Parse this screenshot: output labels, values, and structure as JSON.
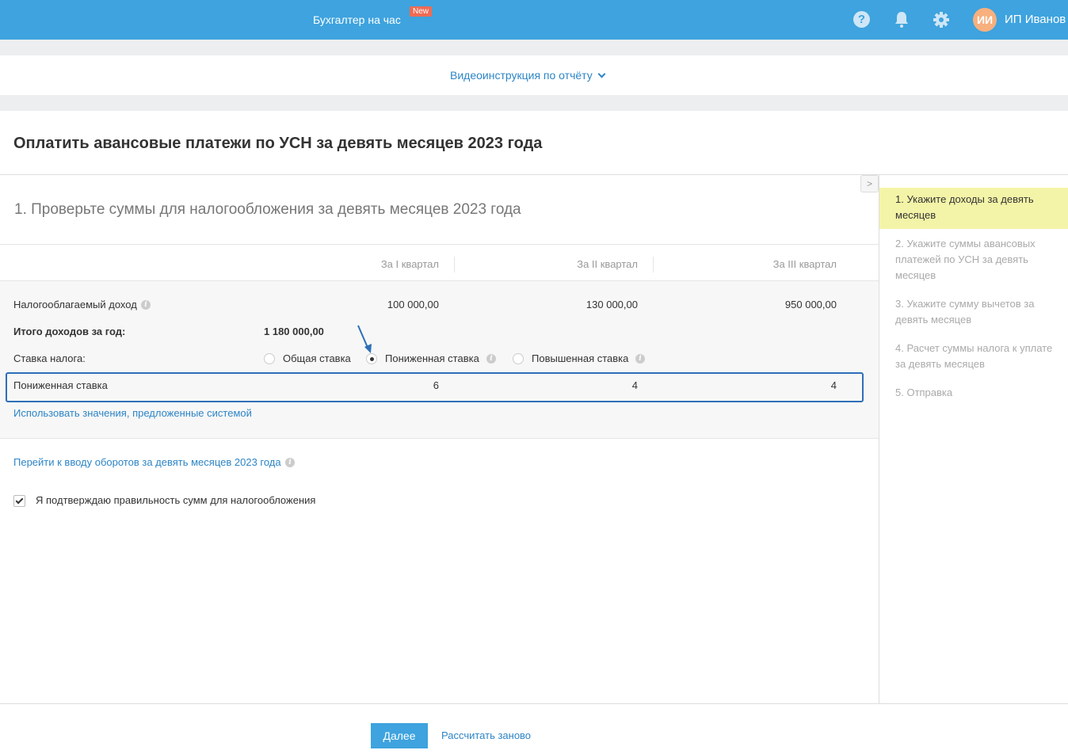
{
  "header": {
    "service_link": "Бухгалтер на час",
    "new_badge": "New",
    "avatar_initials": "ИИ",
    "user_name": "ИП Иванов"
  },
  "video_link": "Видеоинструкция по отчёту",
  "page_title": "Оплатить авансовые платежи по УСН за девять месяцев 2023 года",
  "section_title": "1. Проверьте суммы для налогообложения за девять месяцев 2023 года",
  "table": {
    "columns": [
      "За I квартал",
      "За II квартал",
      "За III квартал"
    ],
    "income_label": "Налогооблагаемый доход",
    "income_values": [
      "100 000,00",
      "130 000,00",
      "950 000,00"
    ],
    "total_label": "Итого доходов за год:",
    "total_value": "1 180 000,00",
    "rate_label": "Ставка налога:",
    "rate_options": [
      "Общая ставка",
      "Пониженная ставка",
      "Повышенная ставка"
    ],
    "selected_rate": "Пониженная ставка",
    "reduced_label": "Пониженная ставка",
    "reduced_values": [
      "6",
      "4",
      "4"
    ],
    "system_values_link": "Использовать значения, предложенные системой"
  },
  "turnover_link": "Перейти к вводу оборотов за девять месяцев 2023 года",
  "confirm_label": "Я подтверждаю правильность сумм для налогообложения",
  "confirm_checked": true,
  "steps": [
    {
      "label": "1.  Укажите доходы за девять месяцев",
      "active": true
    },
    {
      "label": "2.  Укажите суммы авансовых платежей по УСН за девять месяцев"
    },
    {
      "label": "3.  Укажите сумму вычетов за девять месяцев"
    },
    {
      "label": "4.  Расчет суммы налога к уплате за девять месяцев"
    },
    {
      "label": "5.  Отправка"
    }
  ],
  "footer": {
    "next_button": "Далее",
    "recalc_link": "Рассчитать заново"
  },
  "colors": {
    "header": "#3ea3de",
    "accent": "#2d85c6",
    "active_step": "#f4f4a8",
    "badge": "#f06b55",
    "avatar": "#f7b07e"
  }
}
